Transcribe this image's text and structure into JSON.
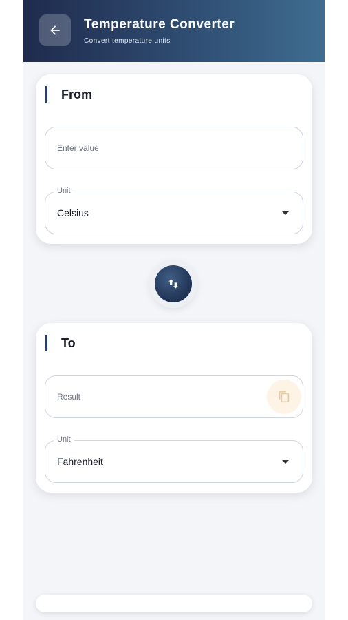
{
  "header": {
    "title": "Temperature Converter",
    "subtitle": "Convert temperature units",
    "back_icon": "arrow-left-icon"
  },
  "from_card": {
    "title": "From",
    "value_placeholder": "Enter value",
    "unit_label": "Unit",
    "unit_value": "Celsius"
  },
  "swap": {
    "icon": "swap-vertical-icon"
  },
  "to_card": {
    "title": "To",
    "result_placeholder": "Result",
    "copy_icon": "copy-icon",
    "unit_label": "Unit",
    "unit_value": "Fahrenheit"
  },
  "colors": {
    "header_start": "#1f2b4d",
    "header_end": "#3e6d90",
    "accent": "#2b3f63",
    "copy_bg": "#fdf4e6",
    "copy_icon": "#e8c9a0",
    "background": "#f3f5f9"
  }
}
